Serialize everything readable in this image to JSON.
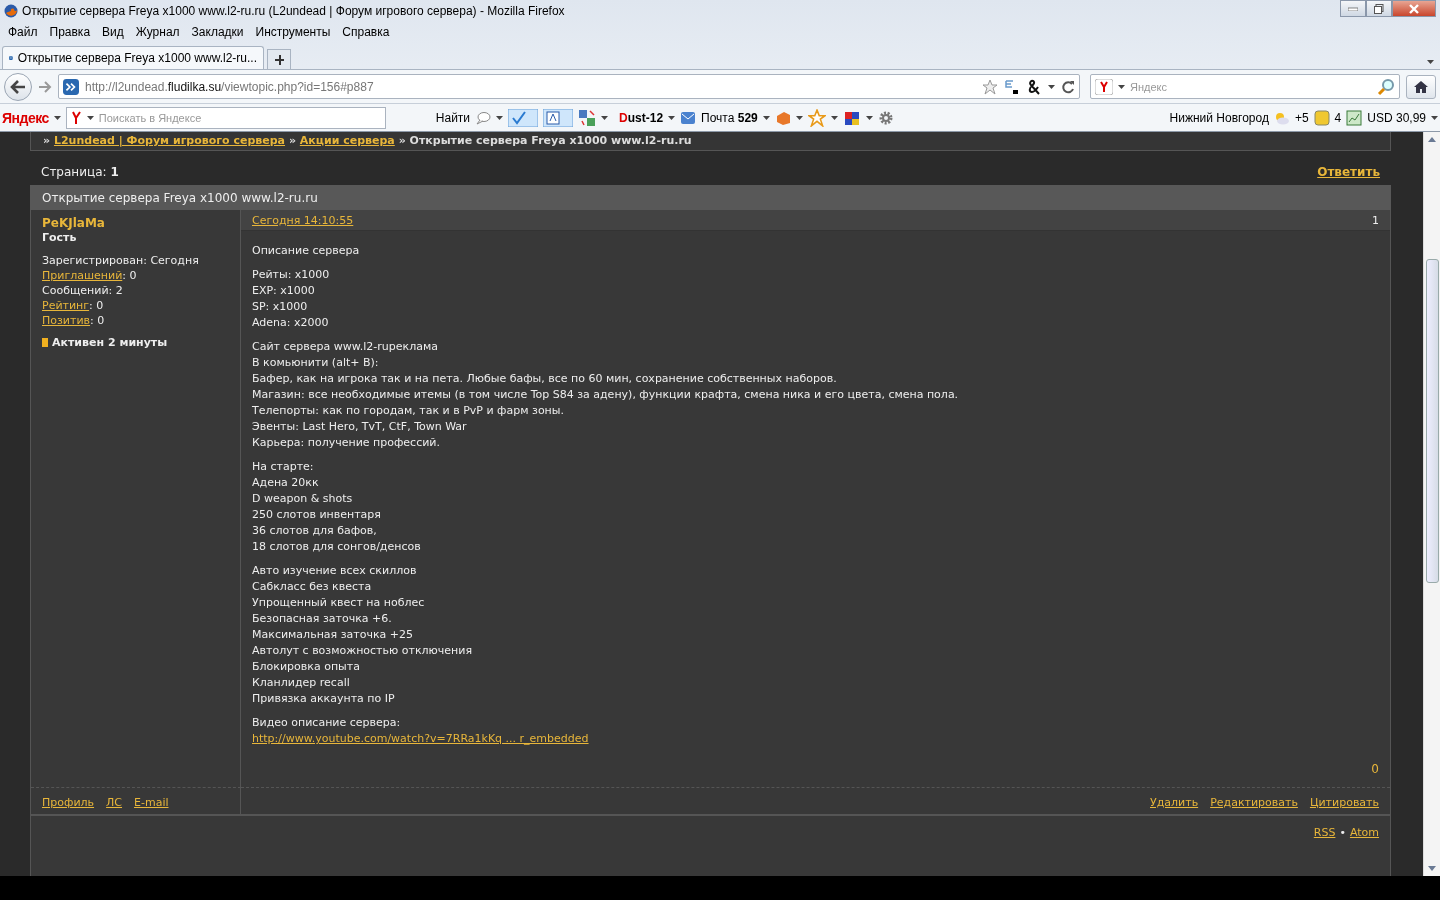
{
  "window": {
    "title": "Открытие сервера Freya x1000 www.l2-ru.ru (L2undead | Форум игрового сервера) - Mozilla Firefox"
  },
  "menu": [
    "Файл",
    "Правка",
    "Вид",
    "Журнал",
    "Закладки",
    "Инструменты",
    "Справка"
  ],
  "tabs": [
    {
      "label": "Открытие сервера Freya x1000 www.l2-ru...",
      "selected": true
    }
  ],
  "address": {
    "value": "http://l2undead.**fludilka.su**/viewtopic.php?id=156#p887"
  },
  "search": {
    "placeholder": "Яндекс"
  },
  "yandex_bar": {
    "logo": "Яндекс",
    "search_placeholder": "Поискать в Яндексе",
    "find": "Найти",
    "dust": "Dust-12",
    "mail_label": "Почта",
    "mail_count": "529",
    "city": "Нижний Новгород",
    "temperature": "+5",
    "traffic": "4",
    "currency": "USD 30,99"
  },
  "forum": {
    "breadcrumb_separator": "»",
    "breadcrumb": [
      {
        "text": "L2undead | Форум игрового сервера",
        "link": true
      },
      {
        "text": "Акции сервера",
        "link": true
      },
      {
        "text": "Открытие сервера Freya x1000 www.l2-ru.ru",
        "link": false
      }
    ],
    "page_label": "Страница:",
    "page": "1",
    "reply": "Ответить",
    "topic_title": "Открытие сервера Freya x1000 www.l2-ru.ru",
    "post": {
      "author": "PeKJlaMa",
      "role": "Гость",
      "stats": [
        {
          "label": "Зарегистрирован",
          "link": false,
          "value": ": Сегодня"
        },
        {
          "label": "Приглашений",
          "link": true,
          "value": ": 0"
        },
        {
          "label": "Сообщений",
          "link": false,
          "value": ": 2"
        },
        {
          "label": "Рейтинг",
          "link": true,
          "value": ": 0"
        },
        {
          "label": "Позитив",
          "link": true,
          "value": ": 0"
        }
      ],
      "status": "Активен 2 минуты",
      "date": "Сегодня 14:10:55",
      "number": "1",
      "paragraphs": [
        [
          "Описание сервера"
        ],
        [
          "Рейты: x1000",
          "EXP: x1000",
          "SP: x1000",
          "Adena: x2000"
        ],
        [
          "Сайт сервера www.l2-ruреклама",
          "В комьюнити (alt+ B):",
          "Бафер, как на игрока так и на пета. Любые бафы, все по 60 мин, сохранение собственных наборов.",
          "Магазин: все необходимые итемы (в том числе Top S84 за адену), функции крафта, смена ника и его цвета, смена пола.",
          "Телепорты: как по городам, так и в PvP и фарм зоны.",
          "Эвенты: Last Hero, TvT, CtF, Town War",
          "Карьера: получение профессий."
        ],
        [
          "На старте:",
          "Адена 20кк",
          "D weapon & shots",
          "250 слотов инвентаря",
          "36 слотов для бафов,",
          "18 слотов для сонгов/денсов"
        ],
        [
          "Авто изучение всех скиллов",
          "Сабкласс без квеста",
          "Упрощенный квест на ноблес",
          "Безопасная заточка +6.",
          "Максимальная заточка +25",
          "Автолут с возможностью отключения",
          "Блокировка опыта",
          "Кланлидер recall",
          "Привязка аккаунта по IP"
        ]
      ],
      "video_label": "Видео описание сервера:",
      "video_link": "http://www.youtube.com/watch?v=7RRa1kKq ... r_embedded",
      "rating": "0",
      "user_links": [
        "Профиль",
        "ЛС",
        "E-mail"
      ],
      "actions": [
        "Удалить",
        "Редактировать",
        "Цитировать"
      ]
    },
    "feeds": [
      "RSS",
      "Atom"
    ],
    "feed_separator": "•"
  }
}
